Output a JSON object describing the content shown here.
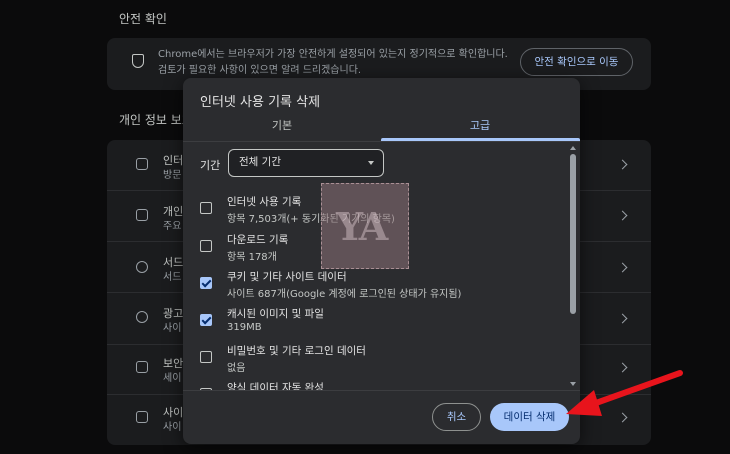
{
  "background": {
    "safety_section_title": "안전 확인",
    "safety_description": "Chrome에서는 브라우저가 가장 안전하게 설정되어 있는지 정기적으로 확인합니다. 검토가 필요한 사항이 있으면 알려 드리겠습니다.",
    "safety_button": "안전 확인으로 이동",
    "privacy_section_title": "개인 정보 보호",
    "rows": [
      {
        "t1": "인터",
        "t2": "방문"
      },
      {
        "t1": "개인",
        "t2": "주요"
      },
      {
        "t1": "서드",
        "t2": "서드"
      },
      {
        "t1": "광고",
        "t2": "사이"
      },
      {
        "t1": "보안",
        "t2": "세이"
      },
      {
        "t1": "사이",
        "t2": "사이"
      }
    ]
  },
  "dialog": {
    "title": "인터넷 사용 기록 삭제",
    "tabs": [
      {
        "label": "기본",
        "active": false
      },
      {
        "label": "고급",
        "active": true
      }
    ],
    "range_label": "기간",
    "range_value": "전체 기간",
    "items": [
      {
        "title": "인터넷 사용 기록",
        "detail": "항목 7,503개(+ 동기화된 기기의 항목)",
        "checked": false
      },
      {
        "title": "다운로드 기록",
        "detail": "항목 178개",
        "checked": false
      },
      {
        "title": "쿠키 및 기타 사이트 데이터",
        "detail": "사이트 687개(Google 계정에 로그인된 상태가 유지됨)",
        "checked": true
      },
      {
        "title": "캐시된 이미지 및 파일",
        "detail": "319MB",
        "checked": true
      },
      {
        "title": "비밀번호 및 기타 로그인 데이터",
        "detail": "없음",
        "checked": false
      },
      {
        "title": "양식 데이터 자동 완성",
        "detail": "",
        "checked": false
      }
    ],
    "cancel_label": "취소",
    "delete_label": "데이터 삭제"
  },
  "colors": {
    "accent": "#a8c7fa",
    "dialog_bg": "#2b2c2f",
    "page_bg": "#0b0b0c",
    "annotation_arrow": "#e8141c"
  }
}
